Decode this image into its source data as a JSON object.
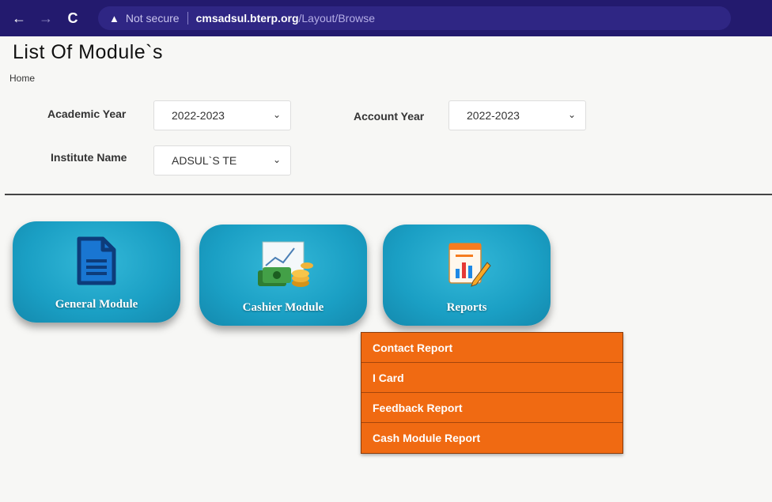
{
  "browser": {
    "back_icon": "arrow-left-icon",
    "forward_icon": "arrow-right-icon",
    "reload_icon": "reload-icon",
    "security_label": "Not secure",
    "url_host": "cmsadsul.bterp.org",
    "url_path": "/Layout/Browse"
  },
  "page": {
    "title": "List Of Module`s",
    "breadcrumb": "Home"
  },
  "filters": {
    "academic_year_label": "Academic Year",
    "academic_year_value": "2022-2023",
    "account_year_label": "Account Year",
    "account_year_value": "2022-2023",
    "institute_label": "Institute Name",
    "institute_value": "ADSUL`S TE"
  },
  "modules": [
    {
      "label": "General Module",
      "icon": "document-icon"
    },
    {
      "label": "Cashier Module",
      "icon": "cash-icon"
    },
    {
      "label": "Reports",
      "icon": "report-icon"
    }
  ],
  "reports_menu": [
    "Contact Report",
    "I Card",
    "Feedback Report",
    "Cash Module Report"
  ],
  "colors": {
    "browser_bar": "#231a6e",
    "tile": "#1a9fc4",
    "menu": "#f06a12"
  }
}
